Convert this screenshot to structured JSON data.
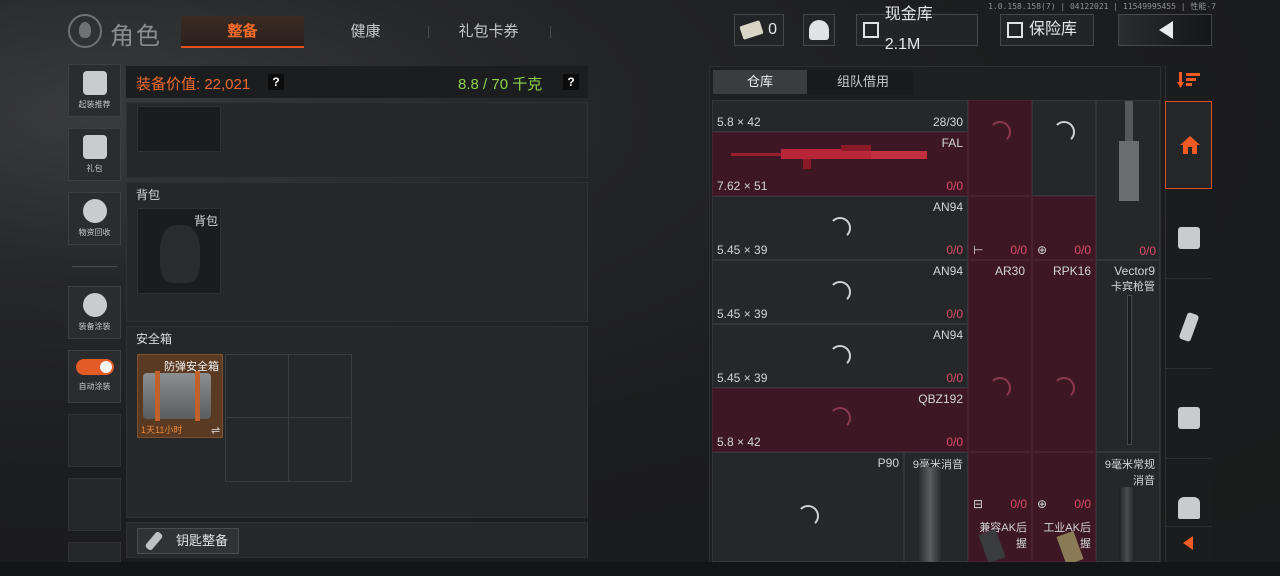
{
  "version_text": "1.0.158.158(7) | 04122021 | 11549995455 | 性能-7",
  "header": {
    "title": "角色",
    "tabs": [
      {
        "label": "整备",
        "active": true
      },
      {
        "label": "健康",
        "active": false
      },
      {
        "label": "礼包卡券",
        "active": false
      }
    ],
    "ticket_count": "0",
    "cash_label": "现金库 2.1M",
    "safe_label": "保险库"
  },
  "sidebar": {
    "items": [
      {
        "label": "起装推荐",
        "icon": "robot-loadout-icon"
      },
      {
        "label": "礼包",
        "icon": "gift-icon"
      },
      {
        "label": "物资回收",
        "icon": "recycle-icon"
      },
      {
        "label": "装备涂装",
        "icon": "helmet-paint-icon"
      },
      {
        "label": "自动涂装",
        "icon": "toggle-icon",
        "toggle_on": true
      }
    ]
  },
  "equipment": {
    "value_label": "装备价值: 22,021",
    "weight_label": "8.8 / 70 千克",
    "help_mark": "?",
    "backpack_section": "背包",
    "backpack_slot": "背包",
    "safe_section": "安全箱",
    "safe_case_name": "防弹安全箱",
    "safe_case_timer": "1天11小时",
    "key_button": "钥匙整备",
    "colors": {
      "value": "#ef6a2c",
      "weight": "#8bd34a",
      "accent": "#e2501f"
    }
  },
  "warehouse": {
    "tabs": [
      {
        "label": "仓库",
        "active": true
      },
      {
        "label": "组队借用",
        "active": false
      }
    ],
    "cells": {
      "r1_ammo": "5.8 × 42",
      "r1_count": "28/30",
      "fal_name": "FAL",
      "fal_ammo": "7.62 × 51",
      "fal_count": "0/0",
      "an94_1_name": "AN94",
      "an94_1_ammo": "5.45 × 39",
      "an94_1_count": "0/0",
      "att1_count": "0/0",
      "att2_count": "0/0",
      "att3_count": "0/0",
      "an94_2_name": "AN94",
      "an94_2_ammo": "5.45 × 39",
      "an94_2_count": "0/0",
      "ar30_name": "AR30",
      "rpk16_name": "RPK16",
      "vector_name": "Vector9",
      "vector_sub": "卡宾枪管",
      "an94_3_name": "AN94",
      "an94_3_ammo": "5.45 × 39",
      "an94_3_count": "0/0",
      "qbz_name": "QBZ192",
      "qbz_ammo": "5.8 × 42",
      "qbz_count": "0/0",
      "p90_name": "P90",
      "suppressor_name": "9毫米消音",
      "ak_grip1_count": "0/0",
      "ak_grip2_count": "0/0",
      "ak_grip1_name": "兼容AK后握",
      "ak_grip2_name": "工业AK后握",
      "normal_suppressor": "9毫米常规消音"
    }
  }
}
